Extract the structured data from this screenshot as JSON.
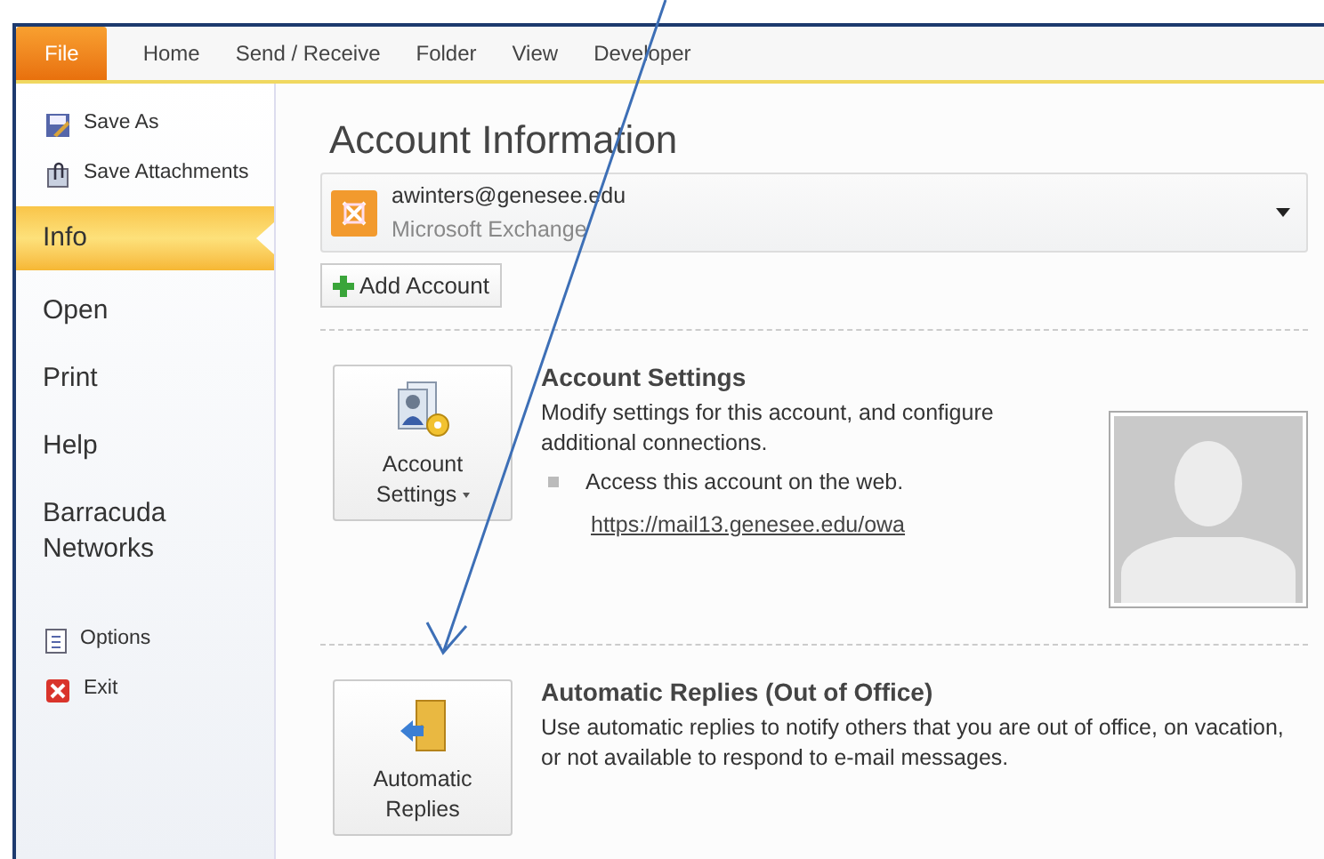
{
  "ribbon_tabs": [
    {
      "label": "File",
      "selected": true
    },
    {
      "label": "Home",
      "selected": false
    },
    {
      "label": "Send / Receive",
      "selected": false
    },
    {
      "label": "Folder",
      "selected": false
    },
    {
      "label": "View",
      "selected": false
    },
    {
      "label": "Developer",
      "selected": false
    }
  ],
  "sidebar": {
    "items": [
      {
        "label": "Save As",
        "kind": "command",
        "selected": false
      },
      {
        "label": "Save Attachments",
        "kind": "command",
        "selected": false
      },
      {
        "label": "Info",
        "kind": "section",
        "selected": true
      },
      {
        "label": "Open",
        "kind": "section",
        "selected": false
      },
      {
        "label": "Print",
        "kind": "section",
        "selected": false
      },
      {
        "label": "Help",
        "kind": "section",
        "selected": false
      },
      {
        "label": "Barracuda Networks",
        "kind": "section",
        "selected": false
      },
      {
        "label": "Options",
        "kind": "command",
        "selected": false
      },
      {
        "label": "Exit",
        "kind": "command",
        "selected": false
      }
    ]
  },
  "title": "Account Information",
  "account": {
    "email": "awinters@genesee.edu",
    "type": "Microsoft Exchange"
  },
  "add_account": "Add Account",
  "sections": [
    {
      "button": "Account Settings",
      "heading": "Account Settings",
      "description": "Modify settings for this account, and configure additional connections.",
      "bullet": "Access this account on the web.",
      "link": "https://mail13.genesee.edu/owa"
    },
    {
      "button": "Automatic Replies",
      "heading": "Automatic Replies (Out of Office)",
      "description": "Use automatic replies to notify others that you are out of office, on vacation, or not available to respond to e-mail messages."
    }
  ]
}
